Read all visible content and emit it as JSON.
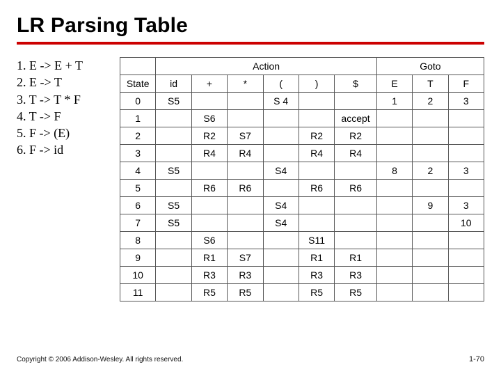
{
  "slide": {
    "title": "LR Parsing Table",
    "footer": "Copyright © 2006 Addison-Wesley. All rights reserved.",
    "page_number": "1-70"
  },
  "grammar": {
    "rules": [
      "1. E -> E + T",
      "2. E -> T",
      "3. T -> T * F",
      "4. T -> F",
      "5. F -> (E)",
      "6. F -> id"
    ]
  },
  "table": {
    "section_headers": {
      "action": "Action",
      "goto": "Goto"
    },
    "col_headers": {
      "state": "State",
      "action": [
        "id",
        "+",
        "*",
        "(",
        ")",
        "$"
      ],
      "goto": [
        "E",
        "T",
        "F"
      ]
    },
    "rows": [
      {
        "state": "0",
        "cells": [
          "S5",
          "",
          "",
          "S 4",
          "",
          "",
          "1",
          "2",
          "3"
        ]
      },
      {
        "state": "1",
        "cells": [
          "",
          "S6",
          "",
          "",
          "",
          "accept",
          "",
          "",
          ""
        ]
      },
      {
        "state": "2",
        "cells": [
          "",
          "R2",
          "S7",
          "",
          "R2",
          "R2",
          "",
          "",
          ""
        ]
      },
      {
        "state": "3",
        "cells": [
          "",
          "R4",
          "R4",
          "",
          "R4",
          "R4",
          "",
          "",
          ""
        ]
      },
      {
        "state": "4",
        "cells": [
          "S5",
          "",
          "",
          "S4",
          "",
          "",
          "8",
          "2",
          "3"
        ]
      },
      {
        "state": "5",
        "cells": [
          "",
          "R6",
          "R6",
          "",
          "R6",
          "R6",
          "",
          "",
          ""
        ]
      },
      {
        "state": "6",
        "cells": [
          "S5",
          "",
          "",
          "S4",
          "",
          "",
          "",
          "9",
          "3"
        ]
      },
      {
        "state": "7",
        "cells": [
          "S5",
          "",
          "",
          "S4",
          "",
          "",
          "",
          "",
          "10"
        ]
      },
      {
        "state": "8",
        "cells": [
          "",
          "S6",
          "",
          "",
          "S11",
          "",
          "",
          "",
          ""
        ]
      },
      {
        "state": "9",
        "cells": [
          "",
          "R1",
          "S7",
          "",
          "R1",
          "R1",
          "",
          "",
          ""
        ]
      },
      {
        "state": "10",
        "cells": [
          "",
          "R3",
          "R3",
          "",
          "R3",
          "R3",
          "",
          "",
          ""
        ]
      },
      {
        "state": "11",
        "cells": [
          "",
          "R5",
          "R5",
          "",
          "R5",
          "R5",
          "",
          "",
          ""
        ]
      }
    ]
  }
}
